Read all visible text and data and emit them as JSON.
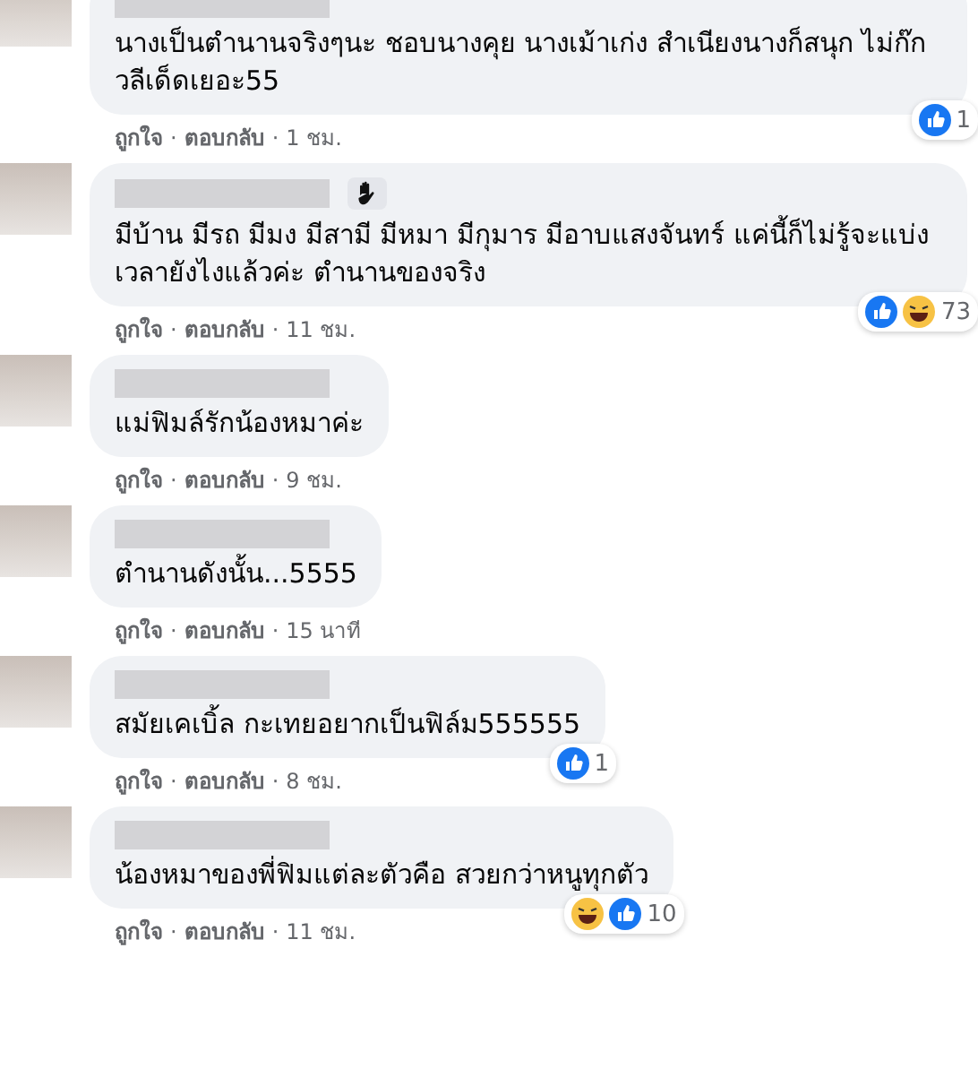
{
  "separator": "·",
  "comments": [
    {
      "badge": false,
      "text": "นางเป็นตำนานจริงๆนะ ชอบนางคุย นางเม้าเก่ง สำเนียงนางก็สนุก ไม่ก๊ก วลีเด็ดเยอะ55",
      "reactions": {
        "icons": [
          {
            "kind": "like"
          }
        ],
        "count": "1"
      },
      "like": "ถูกใจ",
      "reply": "ตอบกลับ",
      "time": "1 ชม."
    },
    {
      "badge": true,
      "text": "มีบ้าน มีรถ มีมง มีสามี มีหมา มีกุมาร มีอาบแสงจันทร์ แค่นี้ก็ไม่รู้จะแบ่งเวลายังไงแล้วค่ะ ตำนานของจริง",
      "reactions": {
        "icons": [
          {
            "kind": "like"
          },
          {
            "kind": "haha"
          }
        ],
        "count": "73"
      },
      "like": "ถูกใจ",
      "reply": "ตอบกลับ",
      "time": "11 ชม."
    },
    {
      "badge": false,
      "text": "แม่ฟิมล์รักน้องหมาค่ะ",
      "like": "ถูกใจ",
      "reply": "ตอบกลับ",
      "time": "9 ชม."
    },
    {
      "badge": false,
      "text": "ตำนานดังนั้น...5555",
      "like": "ถูกใจ",
      "reply": "ตอบกลับ",
      "time": "15 นาที"
    },
    {
      "badge": false,
      "text": "สมัยเคเบิ้ล กะเทยอยากเป็นฟิล์ม555555",
      "reactions": {
        "icons": [
          {
            "kind": "like"
          }
        ],
        "count": "1"
      },
      "like": "ถูกใจ",
      "reply": "ตอบกลับ",
      "time": "8 ชม."
    },
    {
      "badge": false,
      "text": "น้องหมาของพี่ฟิมแต่ละตัวคือ สวยกว่าหนูทุกตัว",
      "reactions": {
        "icons": [
          {
            "kind": "haha"
          },
          {
            "kind": "like"
          }
        ],
        "count": "10"
      },
      "like": "ถูกใจ",
      "reply": "ตอบกลับ",
      "time": "11 ชม."
    }
  ]
}
